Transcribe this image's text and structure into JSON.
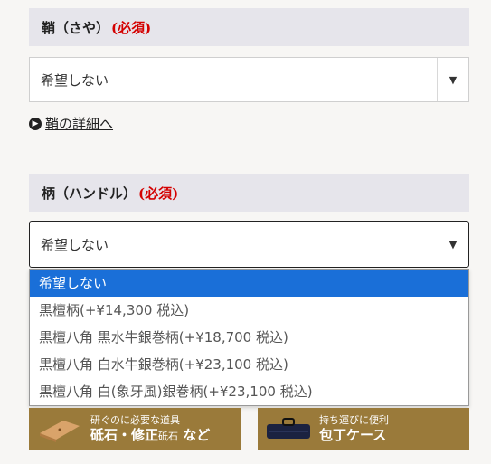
{
  "saya": {
    "title": "鞘（さや）",
    "required": "(必須)",
    "select_value": "希望しない",
    "detail_link": "鞘の詳細へ"
  },
  "handle": {
    "title": "柄（ハンドル）",
    "required": "(必須)",
    "select_value": "希望しない",
    "options": [
      "希望しない",
      "黒檀柄(+¥14,300 税込)",
      "黒檀八角 黒水牛銀巻柄(+¥18,700 税込)",
      "黒檀八角 白水牛銀巻柄(+¥23,100 税込)",
      "黒檀八角 白(象牙風)銀巻柄(+¥23,100 税込)"
    ]
  },
  "banners": {
    "whetstone": {
      "small": "研ぐのに必要な道具",
      "big": "砥石・修正",
      "mini": "砥石",
      "suffix": "など"
    },
    "case": {
      "small": "持ち運びに便利",
      "big": "包丁ケース"
    }
  },
  "colors": {
    "header_bg": "#e6e5eb",
    "required": "#d40000",
    "selected": "#1a6fd8",
    "banner": "#9a7a3a"
  }
}
